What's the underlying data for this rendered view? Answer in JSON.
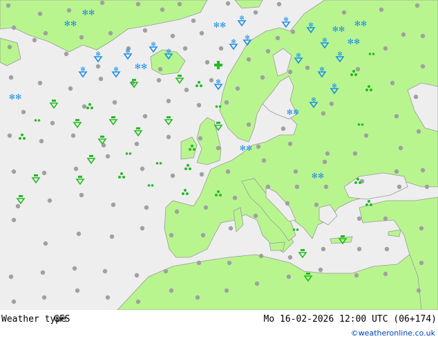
{
  "header": {
    "title": "Weather type",
    "model": "GFS",
    "valid_time": "Mo 16-02-2026 12:00 UTC (06+174)"
  },
  "footer": {
    "credit": "©weatheronline.co.uk"
  },
  "colors": {
    "sea": "#eeeeee",
    "land": "#b9f58f",
    "border": "#999999",
    "rain": "#22bb22",
    "snow": "#1a8fe6",
    "dry": "#a0a0a0"
  },
  "legend_icons": {
    "rain": "rain-drop-icon",
    "showers": "rain-shower-icon",
    "drizzle": "drizzle-dots-icon",
    "snow": "snowflake-icon",
    "snow_shower": "snow-shower-icon",
    "dry": "dry-dot-icon"
  }
}
